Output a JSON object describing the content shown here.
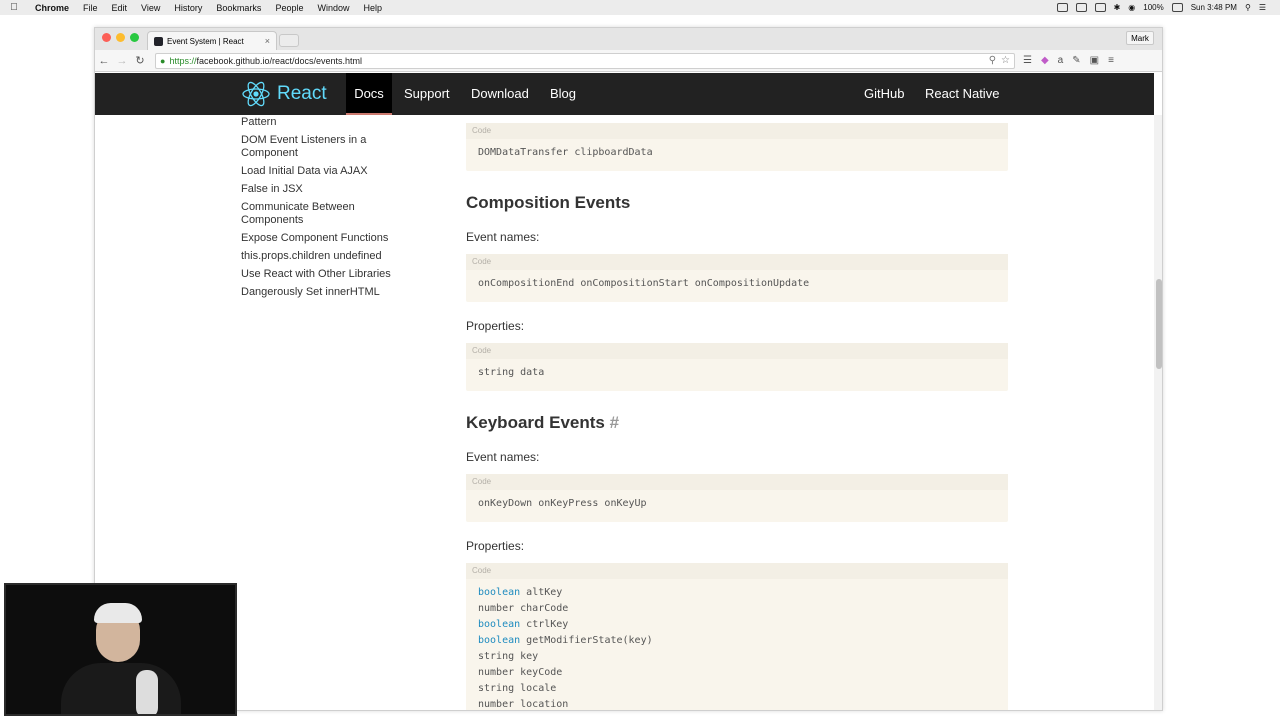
{
  "menubar": {
    "app": "Chrome",
    "items": [
      "File",
      "Edit",
      "View",
      "History",
      "Bookmarks",
      "People",
      "Window",
      "Help"
    ],
    "battery": "100%",
    "clock": "Sun 3:48 PM"
  },
  "browser": {
    "tab_title": "Event System | React",
    "user": "Mark",
    "url_scheme": "https://",
    "url_rest": "facebook.github.io/react/docs/events.html"
  },
  "nav": {
    "brand": "React",
    "links": [
      "Docs",
      "Support",
      "Download",
      "Blog"
    ],
    "right_links": [
      "GitHub",
      "React Native"
    ],
    "active": "Docs"
  },
  "sidebar": {
    "items": [
      "Pattern",
      "DOM Event Listeners in a Component",
      "Load Initial Data via AJAX",
      "False in JSX",
      "Communicate Between Components",
      "Expose Component Functions",
      "this.props.children undefined",
      "Use React with Other Libraries",
      "Dangerously Set innerHTML"
    ]
  },
  "main": {
    "code_label": "Code",
    "clipboard_code": "DOMDataTransfer clipboardData",
    "composition": {
      "title": "Composition Events",
      "event_names_label": "Event names:",
      "event_names_code": "onCompositionEnd onCompositionStart onCompositionUpdate",
      "properties_label": "Properties:",
      "properties_code": "string data"
    },
    "keyboard": {
      "title": "Keyboard Events",
      "anchor": "#",
      "event_names_label": "Event names:",
      "event_names_code": "onKeyDown onKeyPress onKeyUp",
      "properties_label": "Properties:",
      "properties": [
        {
          "type": "boolean",
          "name": "altKey"
        },
        {
          "type": "number",
          "name": "charCode"
        },
        {
          "type": "boolean",
          "name": "ctrlKey"
        },
        {
          "type": "boolean",
          "name": "getModifierState(key)"
        },
        {
          "type": "string",
          "name": "key"
        },
        {
          "type": "number",
          "name": "keyCode"
        },
        {
          "type": "string",
          "name": "locale"
        },
        {
          "type": "number",
          "name": "location"
        }
      ]
    }
  },
  "colors": {
    "nav_bg": "#222222",
    "brand": "#61dafb",
    "keyword": "#1f8cbf",
    "code_bg": "#f9f5ec"
  }
}
